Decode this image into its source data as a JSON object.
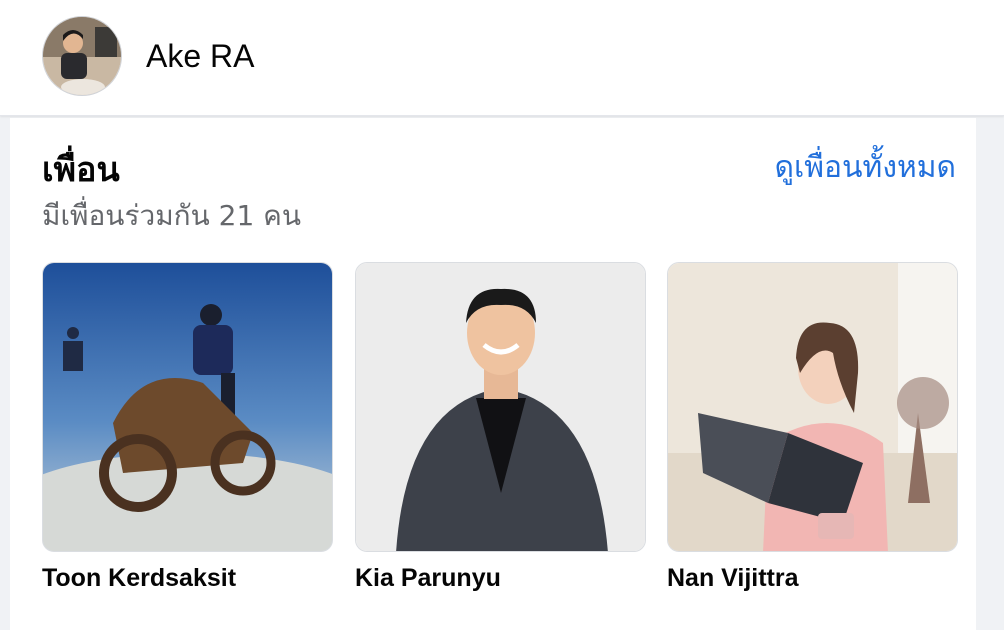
{
  "profile": {
    "name": "Ake RA"
  },
  "friends_section": {
    "title": "เพื่อน",
    "mutual_text": "มีเพื่อนร่วมกัน 21 คน",
    "see_all_label": "ดูเพื่อนทั้งหมด",
    "friends": [
      {
        "name": "Toon Kerdsaksit",
        "photo": "underwater-diver-photo"
      },
      {
        "name": "Kia Parunyu",
        "photo": "portrait-suit-photo"
      },
      {
        "name": "Nan Vijittra",
        "photo": "woman-reading-magazine-photo"
      }
    ]
  },
  "colors": {
    "link": "#216fdb",
    "secondary_text": "#65676b",
    "page_background": "#f0f2f5"
  }
}
